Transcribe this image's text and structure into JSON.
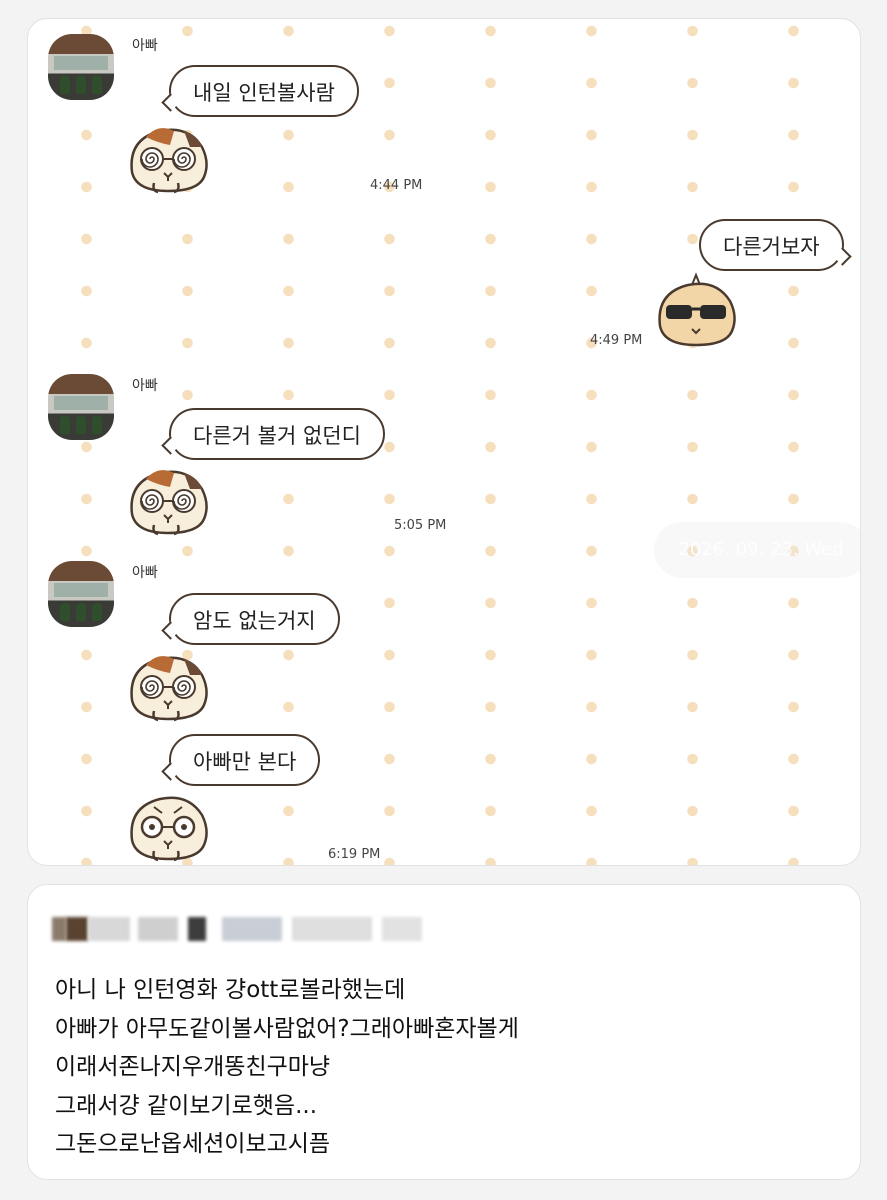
{
  "chat": {
    "sender_name": "아빠",
    "date_pill": "2026. 09. 23. Wed",
    "messages": [
      {
        "text": "내일 인턴볼사람",
        "time": "4:44 PM"
      },
      {
        "text": "다른거보자",
        "time": "4:49 PM"
      },
      {
        "text": "다른거 볼거 없던디",
        "time": "5:05 PM"
      },
      {
        "text": "암도 없는거지",
        "time": ""
      },
      {
        "text": "아빠만 본다",
        "time": "6:19 PM"
      }
    ]
  },
  "post": {
    "lines": [
      "아니 나 인턴영화 걍ott로볼라했는데",
      "아빠가 아무도같이볼사람없어?그래아빠혼자볼게",
      "이래서존나지우개똥친구마냥",
      "그래서걍 같이보기로햇음...",
      "그돈으로난옵세션이보고시픔"
    ]
  },
  "colors": {
    "dot": "#f6dfbd",
    "bubble_border": "#4a3a2e",
    "pig_fur": "#f8eedc",
    "pig_patch": "#b86b35"
  },
  "stickers": [
    "dizzy-guinea-pig-sticker",
    "sunglasses-guinea-pig-sticker",
    "dizzy-guinea-pig-sticker",
    "dizzy-guinea-pig-sticker",
    "glasses-guinea-pig-sticker"
  ]
}
